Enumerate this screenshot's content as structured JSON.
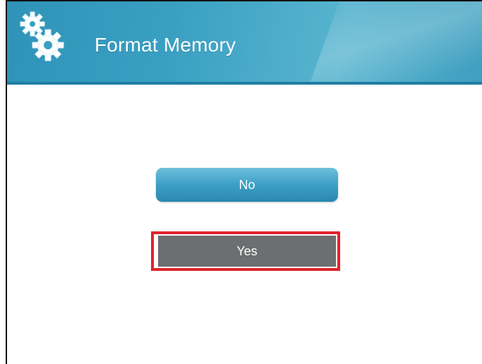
{
  "header": {
    "title": "Format Memory",
    "icon": "gears-icon",
    "color": "#3aa0c2"
  },
  "dialog": {
    "no_label": "No",
    "yes_label": "Yes",
    "highlight_color": "#e0242b",
    "selected_button_color": "#6c6e70"
  }
}
